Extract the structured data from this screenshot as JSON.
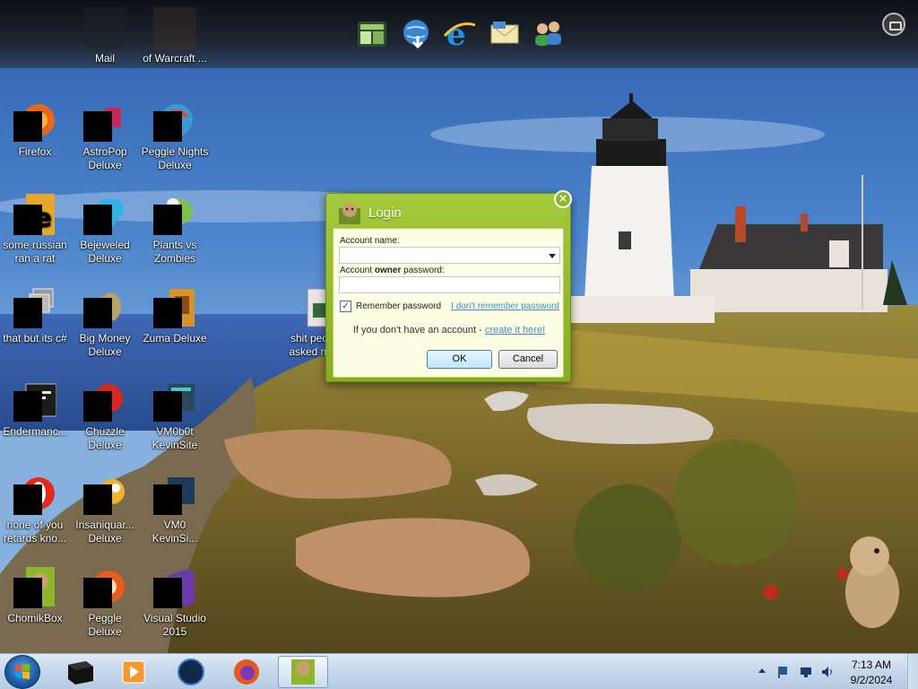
{
  "top_dock": {
    "items": [
      {
        "icon": "grid-app-icon"
      },
      {
        "icon": "globe-download-icon"
      },
      {
        "icon": "internet-explorer-icon"
      },
      {
        "icon": "mail-envelope-icon"
      },
      {
        "icon": "users-icon"
      }
    ],
    "menu_icon": "toolbox-icon"
  },
  "desktop": {
    "icons": [
      {
        "label": "Mail",
        "icon": "mail-icon"
      },
      {
        "label": "of Warcraft ...",
        "icon": "warcraft-icon"
      },
      {
        "label": "Firefox",
        "icon": "firefox-icon"
      },
      {
        "label": "AstroPop\nDeluxe",
        "icon": "astropop-icon"
      },
      {
        "label": "Peggle Nights\nDeluxe",
        "icon": "peggle-nights-icon"
      },
      {
        "label": "some russian\nran a rat",
        "icon": "rat-app-icon"
      },
      {
        "label": "Bejeweled\nDeluxe",
        "icon": "bejeweled-icon"
      },
      {
        "label": "Plants vs\nZombies",
        "icon": "plants-vs-zombies-icon"
      },
      {
        "label": "that but its c#",
        "icon": "windows-stack-icon"
      },
      {
        "label": "Big Money\nDeluxe",
        "icon": "big-money-icon"
      },
      {
        "label": "Zuma Deluxe",
        "icon": "zuma-icon"
      },
      {
        "label": "shit peo\nasked m",
        "icon": "file-icon"
      },
      {
        "label": "Endermanc...",
        "icon": "terminal-icon"
      },
      {
        "label": "Chuzzle\nDeluxe",
        "icon": "chuzzle-icon"
      },
      {
        "label": "VM0b0t\nKevinSite",
        "icon": "vm-icon"
      },
      {
        "label": "none of you\nretards kno...",
        "icon": "opera-icon"
      },
      {
        "label": "Insaniquar...\nDeluxe",
        "icon": "insaniquarium-icon"
      },
      {
        "label": "VM0\nKevinSi...",
        "icon": "vm2-icon"
      },
      {
        "label": "ChomikBox",
        "icon": "chomikbox-icon"
      },
      {
        "label": "Peggle Deluxe",
        "icon": "peggle-icon"
      },
      {
        "label": "Visual Studio\n2015",
        "icon": "visual-studio-icon"
      }
    ]
  },
  "login": {
    "title": "Login",
    "account_name_label": "Account name:",
    "password_label_prefix": "Account ",
    "password_label_bold": "owner",
    "password_label_suffix": " password:",
    "remember_label": "Remember password",
    "remember_checked": true,
    "forgot_link": "I don't remember password",
    "no_account_text": "If you don't have an account - ",
    "create_link": "create it here!",
    "ok_label": "OK",
    "cancel_label": "Cancel",
    "close_glyph": "×",
    "check_glyph": "✓"
  },
  "taskbar": {
    "pinned": [
      {
        "icon": "black-box-icon"
      },
      {
        "icon": "media-player-icon"
      },
      {
        "icon": "dark-globe-icon"
      },
      {
        "icon": "firefox-icon"
      },
      {
        "icon": "chomikbox-icon",
        "active": true
      }
    ],
    "tray": [
      {
        "icon": "show-hidden-icons-icon"
      },
      {
        "icon": "flag-icon"
      },
      {
        "icon": "network-icon"
      },
      {
        "icon": "volume-icon"
      }
    ],
    "clock": {
      "time": "7:13 AM",
      "date": "9/2/2024"
    }
  }
}
